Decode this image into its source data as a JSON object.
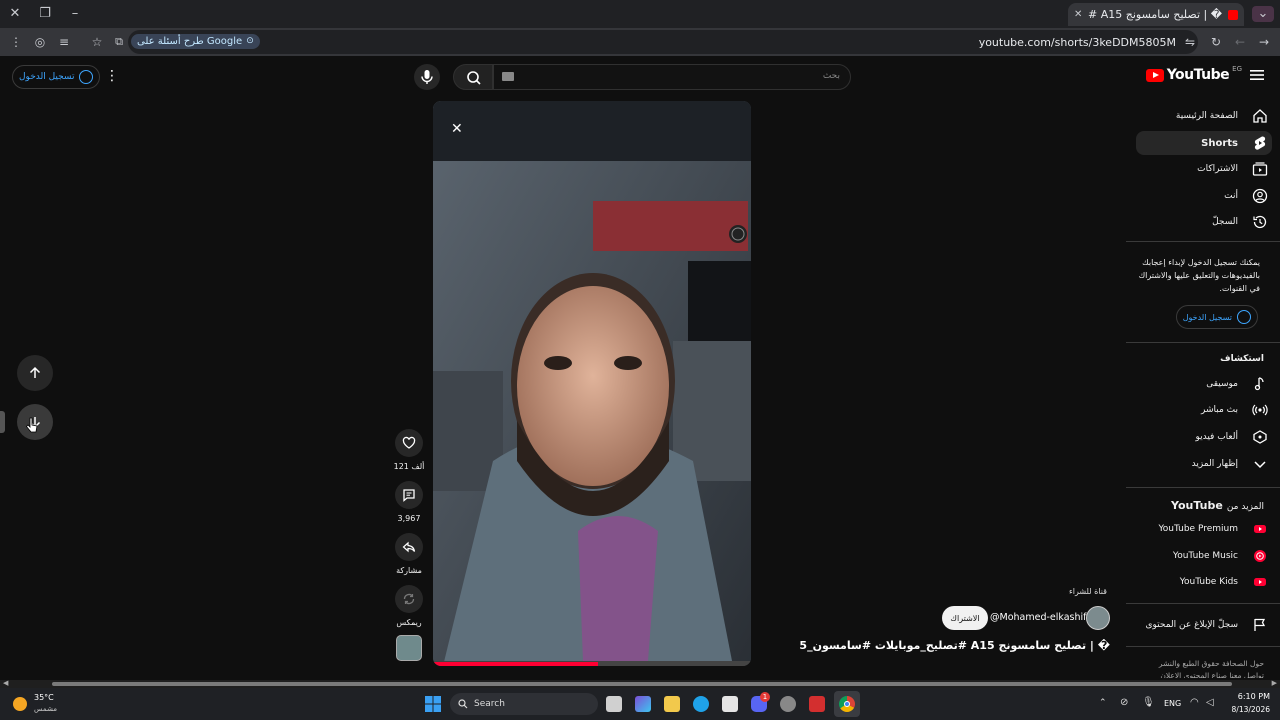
{
  "browser": {
    "tab_title": "� | تصليح سامسونج A15 #ت...",
    "url": "youtube.com/shorts/3keDDM5805M",
    "ask_google_label": "طرح أسئلة على Google"
  },
  "header": {
    "logo_text": "YouTube",
    "region": "EG",
    "search_placeholder": "بحث",
    "signin_label": "تسجيل الدخول"
  },
  "sidebar": {
    "items": [
      {
        "label": "الصفحة الرئيسية",
        "icon": "home-icon"
      },
      {
        "label": "Shorts",
        "icon": "shorts-icon"
      },
      {
        "label": "الاشتراكات",
        "icon": "subscriptions-icon"
      },
      {
        "label": "أنت",
        "icon": "user-icon"
      },
      {
        "label": "السجلّ",
        "icon": "history-icon"
      }
    ],
    "signin_prompt": "يمكنك تسجيل الدخول لإبداء إعجابك بالفيديوهات والتعليق عليها والاشتراك في القنوات.",
    "signin_label": "تسجيل الدخول",
    "explore_heading": "استكشاف",
    "explore": [
      {
        "label": "موسيقى",
        "icon": "music-icon"
      },
      {
        "label": "بث مباشر",
        "icon": "live-icon"
      },
      {
        "label": "ألعاب فيديو",
        "icon": "gaming-icon"
      },
      {
        "label": "إظهار المزيد",
        "icon": "chevron-down-icon"
      }
    ],
    "more_from_heading": "المزيد من",
    "more_from_brand": "YouTube",
    "more_from": [
      {
        "label": "YouTube Premium",
        "icon": "premium-icon"
      },
      {
        "label": "YouTube Music",
        "icon": "yt-music-icon"
      },
      {
        "label": "YouTube Kids",
        "icon": "kids-icon"
      }
    ],
    "report_label": "سجلّ الإبلاغ عن المحتوى",
    "footer_line1": "حول  الصحافة  حقوق الطبع والنشر",
    "footer_line2": "تواصل معنا  صناع المحتوى  الإعلان"
  },
  "short": {
    "channel_tag": "قناة للشراء",
    "channel_handle": "@Mohamed-elkashif",
    "subscribe_label": "الاشتراك",
    "title": "� | تصليح سامسونج A15 #تصليح_موبايلات #سامسون_A15 ...",
    "progress": 0.52,
    "actions": {
      "likes": "121 ألف",
      "comments": "3,967",
      "share": "مشاركة",
      "remix": "ريمكس"
    }
  },
  "taskbar": {
    "weather_temp": "35°C",
    "weather_desc": "مشمس",
    "search_label": "Search",
    "language": "ENG",
    "time": "6:10 PM",
    "date": "8/13/2026",
    "badge_count": "1"
  }
}
